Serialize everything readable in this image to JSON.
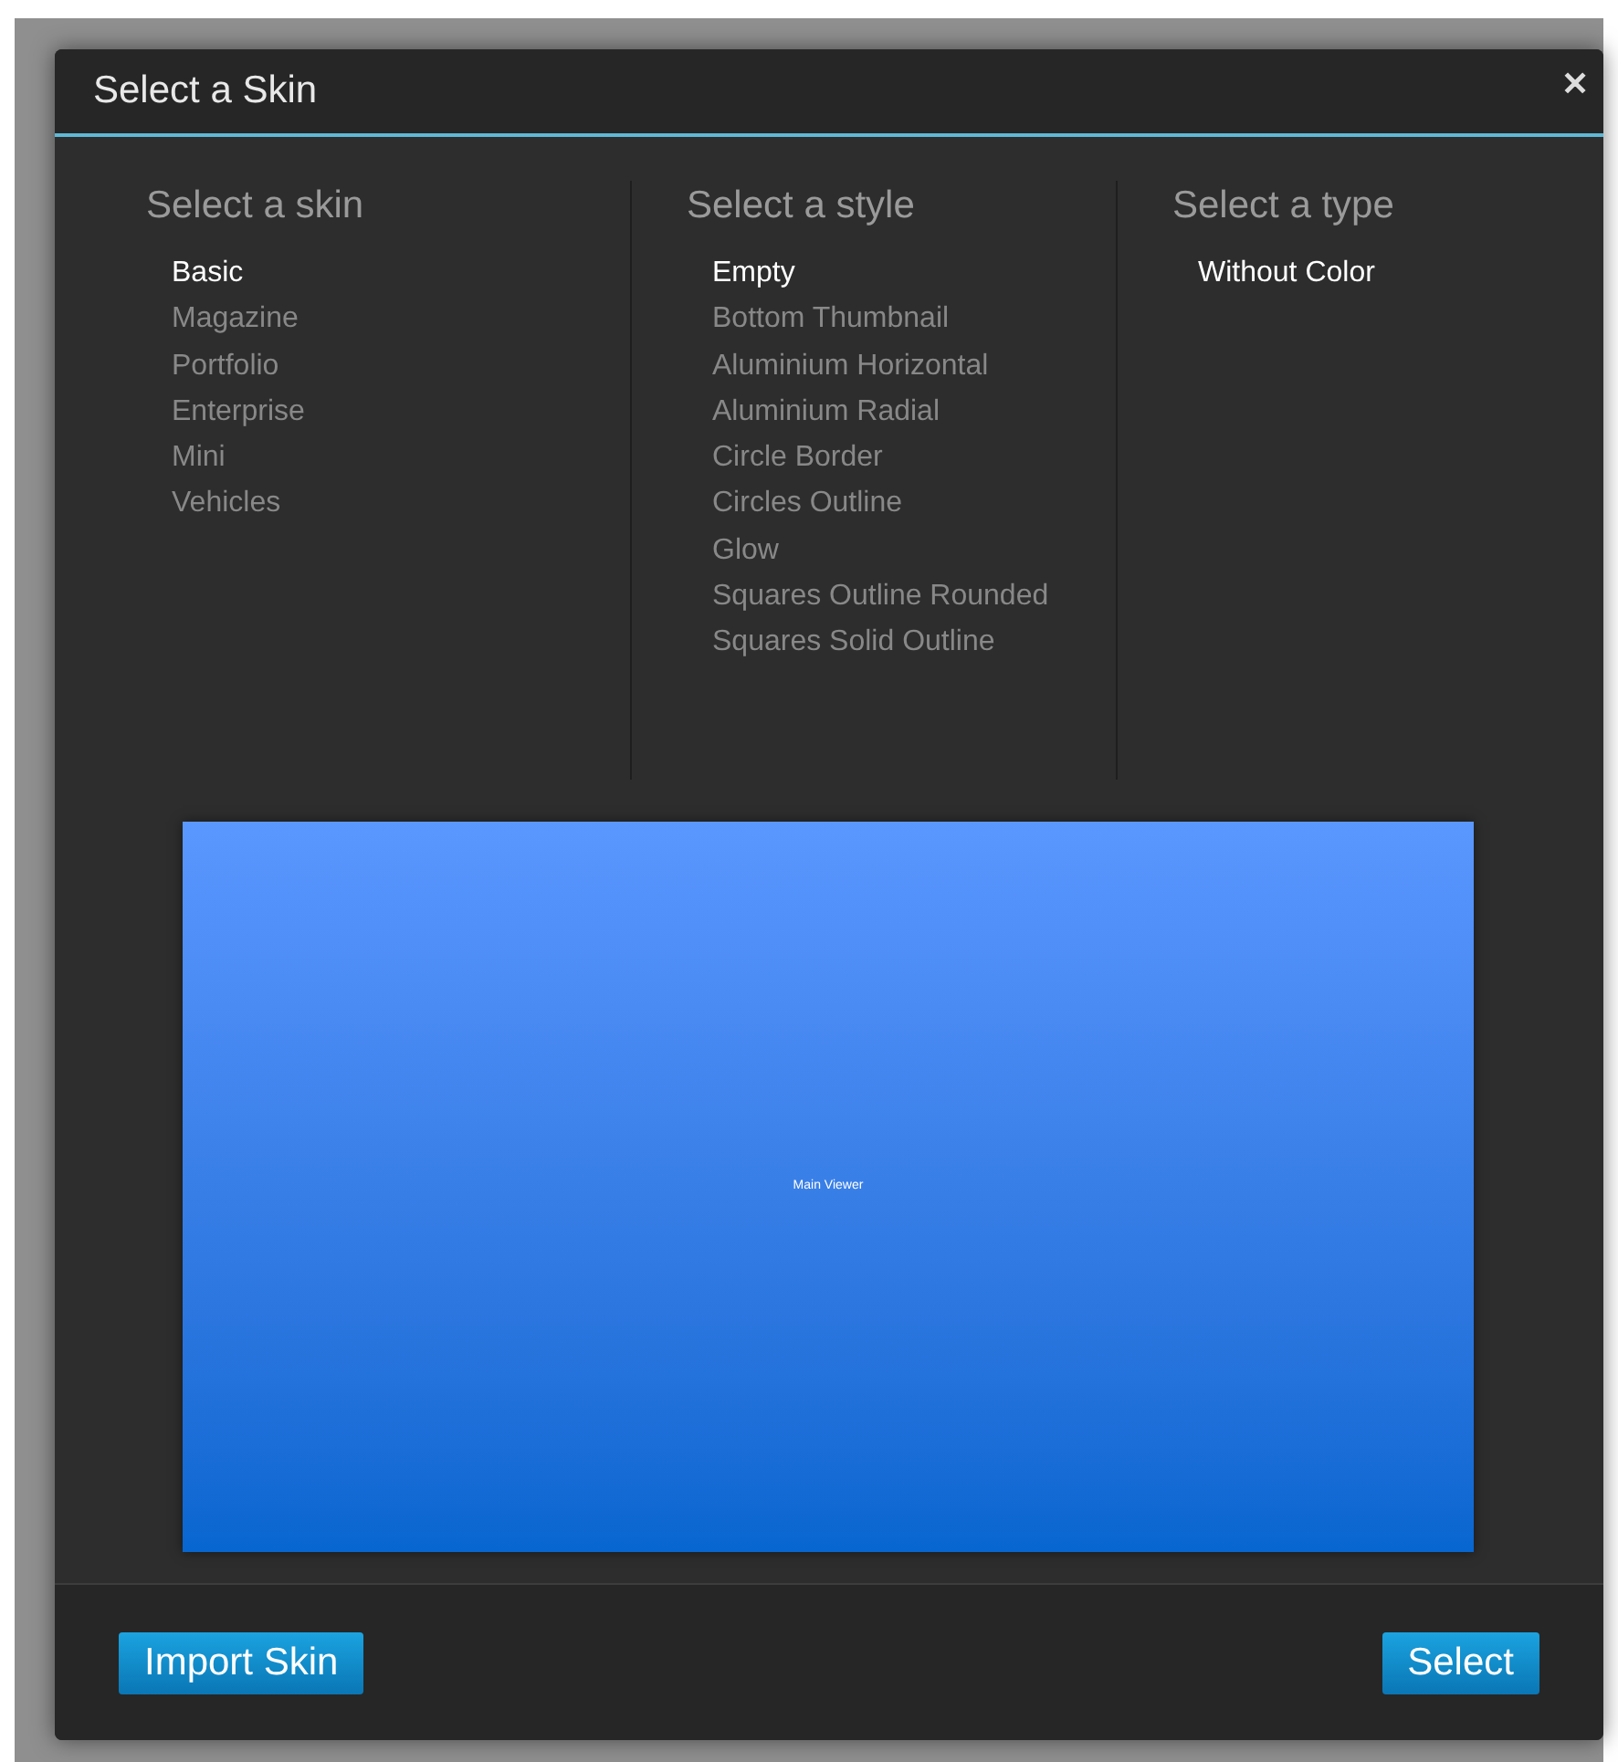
{
  "dialog": {
    "title": "Select a Skin",
    "close": "✕"
  },
  "columns": [
    {
      "heading": "Select a skin",
      "items": [
        {
          "label": "Basic",
          "selected": true
        },
        {
          "label": "Magazine",
          "selected": false
        },
        {
          "label": "Portfolio",
          "selected": false
        },
        {
          "label": "Enterprise",
          "selected": false
        },
        {
          "label": "Mini",
          "selected": false
        },
        {
          "label": "Vehicles",
          "selected": false
        }
      ]
    },
    {
      "heading": "Select a style",
      "items": [
        {
          "label": "Empty",
          "selected": true
        },
        {
          "label": "Bottom Thumbnail",
          "selected": false
        },
        {
          "label": "Aluminium Horizontal",
          "selected": false
        },
        {
          "label": "Aluminium Radial",
          "selected": false
        },
        {
          "label": "Circle Border",
          "selected": false
        },
        {
          "label": "Circles Outline",
          "selected": false
        },
        {
          "label": "Glow",
          "selected": false
        },
        {
          "label": "Squares Outline Rounded",
          "selected": false
        },
        {
          "label": "Squares Solid Outline",
          "selected": false
        }
      ]
    },
    {
      "heading": "Select a type",
      "items": [
        {
          "label": "Without Color",
          "selected": true
        }
      ]
    }
  ],
  "preview": {
    "label": "Main Viewer"
  },
  "buttons": [
    "Import Skin",
    "Select"
  ]
}
